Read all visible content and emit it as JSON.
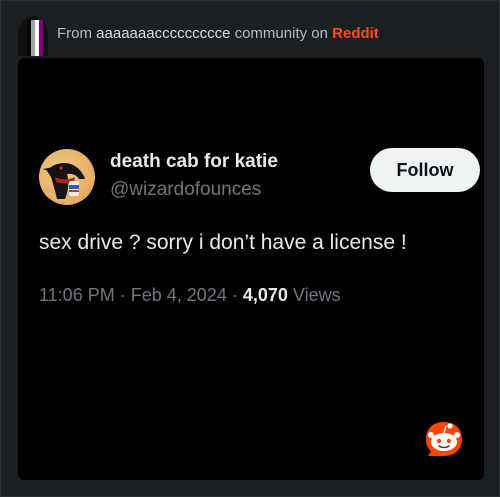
{
  "source": {
    "prefix": "From",
    "community": "aaaaaaaccccccccce",
    "middle": "community on",
    "brand": "Reddit"
  },
  "tweet": {
    "display_name": "death cab for katie",
    "handle": "@wizardofounces",
    "follow_label": "Follow",
    "text": "sex drive ? sorry i don’t have a license !",
    "time": "11:06 PM",
    "separator": "·",
    "date": "Feb 4, 2024",
    "views_count": "4,070",
    "views_label": "Views"
  },
  "colors": {
    "brand": "#ff4c1a",
    "flag": [
      "#000000",
      "#a3a3a3",
      "#ffffff",
      "#800080"
    ]
  },
  "icons": {
    "community_avatar": "asexual-flag-avatar",
    "user_avatar": "crow-avatar",
    "corner_logo": "reddit-snoo-icon"
  }
}
